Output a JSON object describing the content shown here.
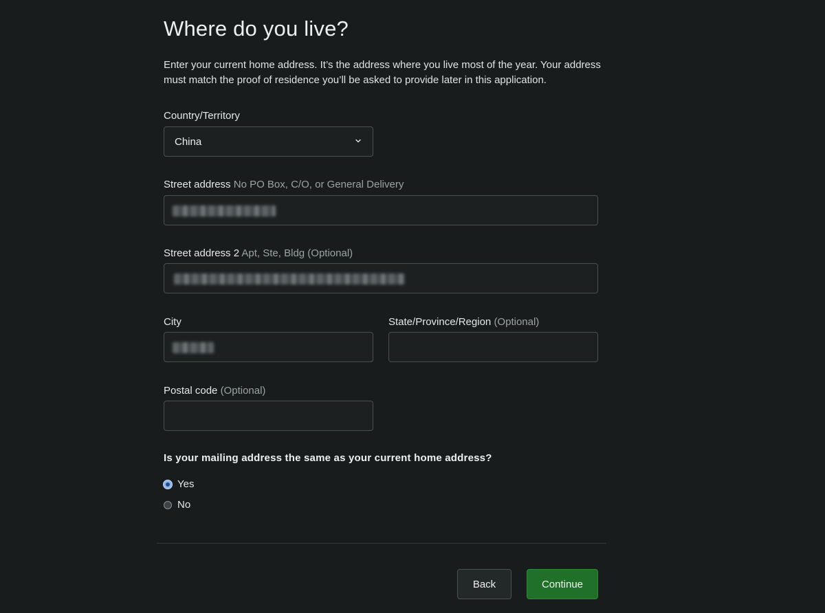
{
  "page": {
    "title": "Where do you live?",
    "intro": "Enter your current home address. It’s the address where you live most of the year. Your address must match the proof of residence you’ll be asked to provide later in this application."
  },
  "form": {
    "country": {
      "label": "Country/Territory",
      "value": "China"
    },
    "street1": {
      "label": "Street address",
      "hint": "No PO Box, C/O, or General Delivery",
      "value": ""
    },
    "street2": {
      "label": "Street address 2",
      "hint": "Apt, Ste, Bldg (Optional)",
      "value": ""
    },
    "city": {
      "label": "City",
      "value": ""
    },
    "state": {
      "label": "State/Province/Region",
      "hint": "(Optional)",
      "value": ""
    },
    "postal": {
      "label": "Postal code",
      "hint": "(Optional)",
      "value": ""
    },
    "mailing": {
      "question": "Is your mailing address the same as your current home address?",
      "options": [
        {
          "label": "Yes",
          "checked": true
        },
        {
          "label": "No",
          "checked": false
        }
      ]
    }
  },
  "actions": {
    "back_label": "Back",
    "continue_label": "Continue"
  },
  "colors": {
    "background": "#181c1d",
    "primary_button": "#207029",
    "radio_selected": "#8fb6e8"
  },
  "icons": {
    "select_indicator": "chevron-down-icon"
  }
}
